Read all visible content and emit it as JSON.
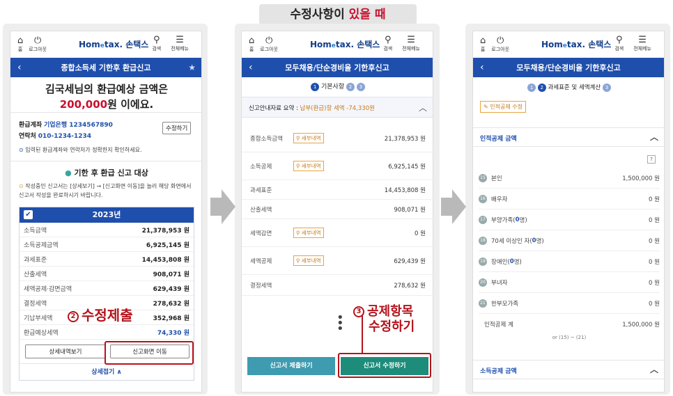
{
  "banner": {
    "normal": "수정사항이 ",
    "highlight": "있을 때"
  },
  "topbar": {
    "home": "홈",
    "logout": "로그아웃",
    "search": "검색",
    "menu": "전체메뉴",
    "logo_a": "Hom",
    "logo_e": "e",
    "logo_b": "tax. 손택스"
  },
  "phone1": {
    "nav_title": "종합소득세 기한후 환급신고",
    "headline_1": "김국세님의 ",
    "headline_2": "환급예상 금액은",
    "amount": "200,000",
    "amount_suffix": "원 이에요.",
    "account_label": "환급계좌",
    "account_value": "기업은행 1234567890",
    "phone_label": "연락처",
    "phone_value": "010-1234-1234",
    "edit_btn": "수정하기",
    "notice": "입력된 환급계좌와 연락처가 정확한지 확인하세요.",
    "section_title": "기한 후 환급 신고 대상",
    "guide": "작성중인 신고서는 [상세보기] → [신고화면 이동]을 눌러 해당 화면에서 신고서 작성을 완료하시기 바랍니다.",
    "year": "2023년",
    "rows": [
      {
        "label": "소득금액",
        "value": "21,378,953",
        "unit": "원"
      },
      {
        "label": "소득공제금액",
        "value": "6,925,145",
        "unit": "원"
      },
      {
        "label": "과세표준",
        "value": "14,453,808",
        "unit": "원"
      },
      {
        "label": "산출세액",
        "value": "908,071",
        "unit": "원"
      },
      {
        "label": "세액공제·감면금액",
        "value": "629,439",
        "unit": "원"
      },
      {
        "label": "결정세액",
        "value": "278,632",
        "unit": "원"
      },
      {
        "label": "기납부세액",
        "value": "352,968",
        "unit": "원"
      },
      {
        "label": "환급예상세액",
        "value": "74,330",
        "unit": "원"
      }
    ],
    "btn_detail": "상세내역보기",
    "btn_move": "신고화면 이동",
    "fold": "상세접기 ∧",
    "annot_num": "2",
    "annot_text": "수정제출"
  },
  "phone2": {
    "nav_title": "모두채용/단순경비율 기한후신고",
    "step_label": "기본사항",
    "summary_a": "신고안내자료 요약 : ",
    "summary_b": "납부(환급)할 세액 -74,330원",
    "tag": "세부내역",
    "rows": [
      {
        "label": "종합소득금액",
        "tag": true,
        "value": "21,378,953",
        "unit": "원"
      },
      {
        "label": "소득공제",
        "tag": true,
        "value": "6,925,145",
        "unit": "원"
      },
      {
        "label": "과세표준",
        "tag": false,
        "value": "14,453,808",
        "unit": "원"
      },
      {
        "label": "산출세액",
        "tag": false,
        "value": "908,071",
        "unit": "원"
      },
      {
        "label": "세액감면",
        "tag": true,
        "value": "0",
        "unit": "원"
      },
      {
        "label": "세액공제",
        "tag": true,
        "value": "629,439",
        "unit": "원"
      },
      {
        "label": "결정세액",
        "tag": false,
        "value": "278,632",
        "unit": "원"
      }
    ],
    "btn_submit": "신고서 제출하기",
    "btn_edit": "신고서 수정하기",
    "annot_num": "3",
    "annot_line1": "공제항목",
    "annot_line2": "수정하기"
  },
  "phone3": {
    "nav_title": "모두채용/단순경비율 기한후신고",
    "step_label": "과세표준 및 세액계산",
    "edit_btn": "인적공제 수정",
    "section": "인적공제 금액",
    "rows": [
      {
        "num": "15",
        "label": "본인",
        "value": "1,500,000",
        "unit": "원"
      },
      {
        "num": "16",
        "label": "배우자",
        "value": "0",
        "unit": "원"
      },
      {
        "num": "17",
        "label": "부양가족(",
        "count": "0",
        "suffix": "명)",
        "value": "0",
        "unit": "원"
      },
      {
        "num": "18",
        "label": "70세 이상인 자(",
        "count": "0",
        "suffix": "명)",
        "value": "0",
        "unit": "원"
      },
      {
        "num": "19",
        "label": "장애인(",
        "count": "0",
        "suffix": "명)",
        "value": "0",
        "unit": "원"
      },
      {
        "num": "20",
        "label": "부녀자",
        "value": "0",
        "unit": "원"
      },
      {
        "num": "21",
        "label": "한부모가족",
        "value": "0",
        "unit": "원"
      }
    ],
    "total_label": "인적공제 계",
    "total_value": "1,500,000",
    "total_unit": "원",
    "formula": "or (15) ~ (21)",
    "section2": "소득공제 금액"
  },
  "colors": {
    "nav": "#1f4fad",
    "accent_red": "#c8102e",
    "annot": "#b5121b",
    "bg": "#eeeeee"
  }
}
